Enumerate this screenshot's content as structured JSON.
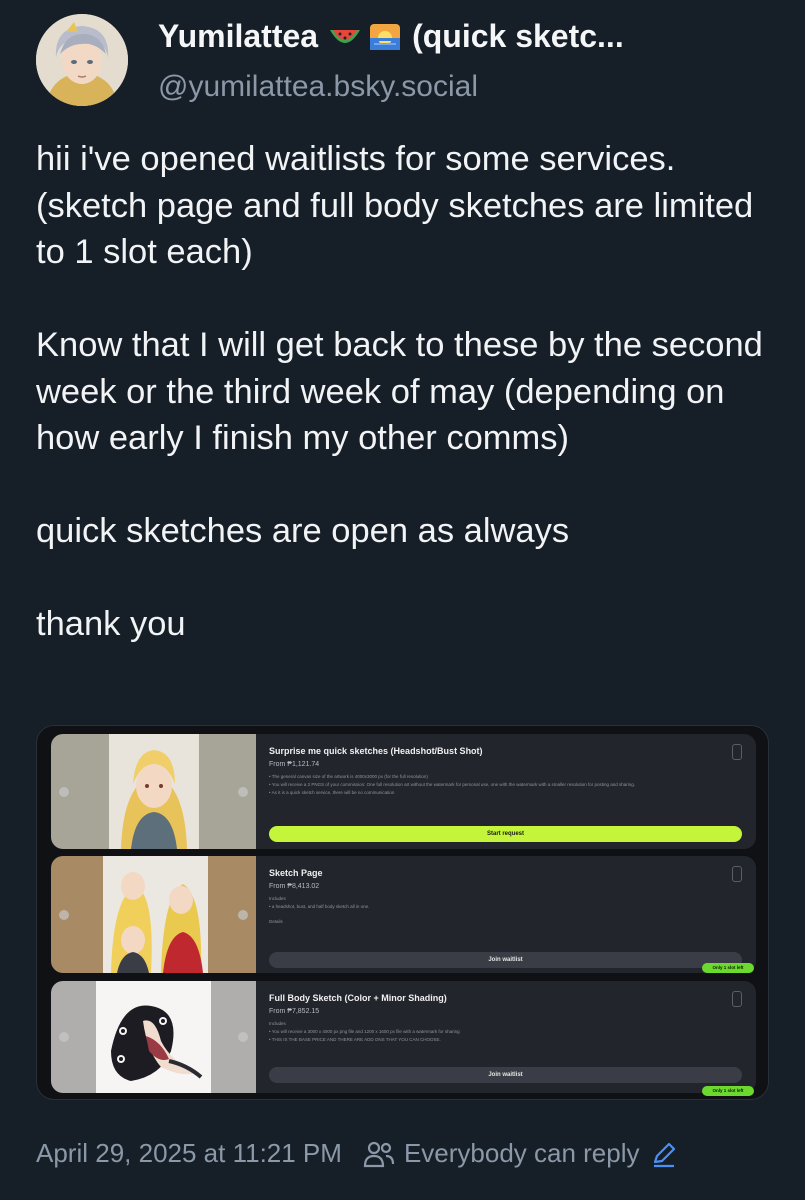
{
  "author": {
    "display_name": "Yumilattea",
    "name_suffix": "(quick sketc...",
    "emojis": [
      "watermelon-emoji",
      "sunrise-emoji"
    ],
    "handle": "@yumilattea.bsky.social",
    "avatar": "avatar-icon"
  },
  "post": {
    "paragraphs": [
      "hii i've opened waitlists for some services. (sketch page and full body sketches are limited to 1 slot each)",
      "Know that I will get back to these by the second week or the third week of may (depending on how early I finish my other comms)",
      "quick sketches are open as always",
      "thank you"
    ]
  },
  "embed": {
    "cards": [
      {
        "title": "Surprise me quick sketches (Headshot/Bust Shot)",
        "price": "From ₱1,121.74",
        "lines": [
          "• The general canvas size of the artwork is 4000x3000 px (for the full resolution)",
          "• You will receive a 2 PNGS of your commission: One full resolution art without the watermark for personal use, one with the watermark with a smaller resolution for posting and sharing.",
          "• As it is a quick sketch service, there will be no communication"
        ],
        "button": "Start request"
      },
      {
        "title": "Sketch Page",
        "price": "From ₱8,413.02",
        "section_label": "Includes",
        "lines": [
          "• a headshot, bust, and half body sketch all in one."
        ],
        "details_label": "Details",
        "button": "Join waitlist",
        "badge": "Only 1 slot left"
      },
      {
        "title": "Full Body Sketch (Color + Minor Shading)",
        "price": "From ₱7,852.15",
        "section_label": "Includes",
        "lines": [
          "• You will receive a 3000 x 4000 px png file and 1200 x 1600 px file with a watermark for sharing",
          "• THIS IS THE BASE PRICE AND THERE ARE ADD ONS THAT YOU CAN CHOOSE."
        ],
        "button": "Join waitlist",
        "badge": "Only 1 slot left"
      }
    ]
  },
  "footer": {
    "timestamp": "April 29, 2025 at 11:21 PM",
    "reply_setting": "Everybody can reply"
  },
  "colors": {
    "background": "#161e27",
    "muted_text": "#8b98a8",
    "accent_button": "#c4f53a",
    "badge": "#6cd92f",
    "link_icon": "#4a90f5"
  }
}
